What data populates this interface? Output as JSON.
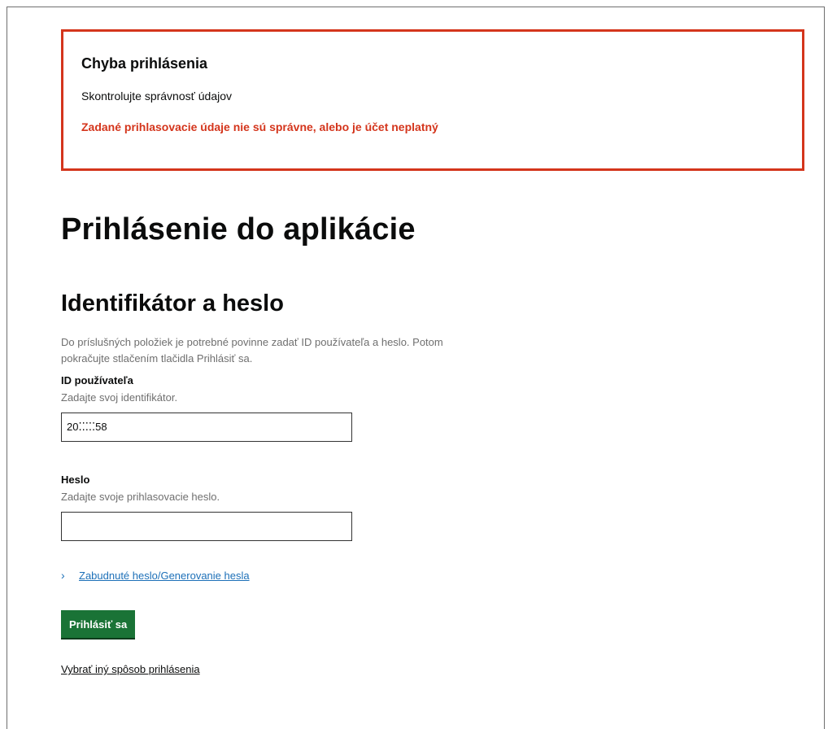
{
  "error_summary": {
    "title": "Chyba prihlásenia",
    "body": "Skontrolujte správnosť údajov",
    "item": "Zadané prihlasovacie údaje nie sú správne, alebo je účet neplatný"
  },
  "page_title": "Prihlásenie do aplikácie",
  "section_title": "Identifikátor a heslo",
  "intro": "Do príslušných položiek je potrebné povinne zadať ID používateľa a heslo. Potom pokračujte stlačením tlačidla Prihlásiť sa.",
  "user_id": {
    "label": "ID používateľa",
    "hint": "Zadajte svoj identifikátor.",
    "value": "20⁚⁚⁚⁚⁚58"
  },
  "password": {
    "label": "Heslo",
    "hint": "Zadajte svoje prihlasovacie heslo.",
    "value": ""
  },
  "forgot_link": "Zabudnuté heslo/Generovanie hesla",
  "submit_label": "Prihlásiť sa",
  "alt_login_link": "Vybrať iný spôsob prihlásenia",
  "colors": {
    "error": "#d4351c",
    "button": "#1a7336",
    "link": "#1d70b8"
  }
}
